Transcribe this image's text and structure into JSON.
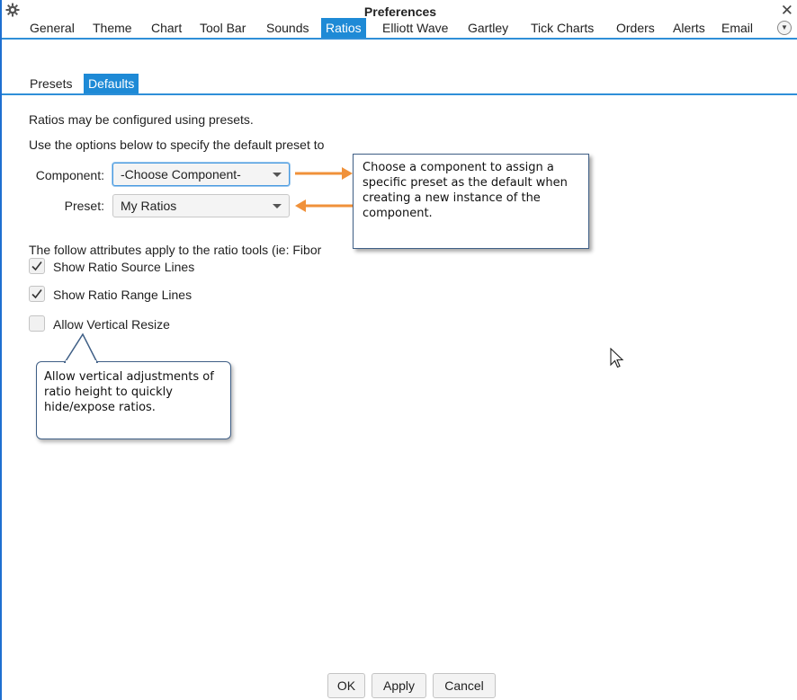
{
  "window": {
    "title": "Preferences"
  },
  "main_tabs": [
    {
      "label": "General"
    },
    {
      "label": "Theme"
    },
    {
      "label": "Chart"
    },
    {
      "label": "Tool Bar"
    },
    {
      "label": "Sounds"
    },
    {
      "label": "Ratios"
    },
    {
      "label": "Elliott Wave"
    },
    {
      "label": "Gartley"
    },
    {
      "label": "Tick Charts"
    },
    {
      "label": "Orders"
    },
    {
      "label": "Alerts"
    },
    {
      "label": "Email"
    }
  ],
  "active_main_tab": "Ratios",
  "sub_tabs": [
    {
      "label": "Presets"
    },
    {
      "label": "Defaults"
    }
  ],
  "active_sub_tab": "Defaults",
  "content": {
    "intro1": "Ratios may be configured using presets.",
    "intro2": "Use the options below to specify the default preset to",
    "component_label": "Component:",
    "component_value": "-Choose Component-",
    "preset_label": "Preset:",
    "preset_value": "My Ratios",
    "attributes_text": "The follow attributes apply to the ratio tools (ie: Fibor",
    "checkboxes": [
      {
        "label": "Show Ratio Source Lines",
        "checked": true
      },
      {
        "label": "Show Ratio Range Lines",
        "checked": true
      },
      {
        "label": "Allow Vertical Resize",
        "checked": false
      }
    ]
  },
  "callouts": {
    "component_tip": "Choose a component to assign a specific preset as the default when creating a new instance of the component.",
    "resize_tip": "Allow vertical adjustments of ratio height to quickly hide/expose ratios."
  },
  "buttons": {
    "ok": "OK",
    "apply": "Apply",
    "cancel": "Cancel"
  },
  "colors": {
    "accent": "#1e8ad6",
    "arrow": "#f0913a",
    "callout_border": "#3f5f86"
  },
  "icons": {
    "settings": "gear-icon",
    "close": "close-icon",
    "more_tabs": "chevron-down-icon"
  }
}
